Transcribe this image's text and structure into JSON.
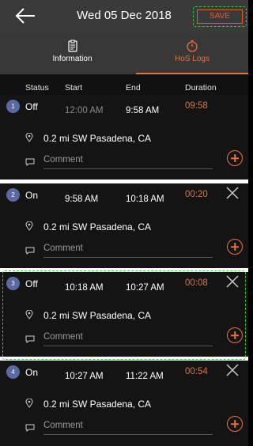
{
  "header": {
    "title": "Wed 05 Dec 2018",
    "save_label": "SAVE"
  },
  "tabs": [
    {
      "label": "Information",
      "icon": "clipboard-icon"
    },
    {
      "label": "HoS Logs",
      "icon": "timer-icon"
    }
  ],
  "columns": {
    "status": "Status",
    "start": "Start",
    "end": "End",
    "duration": "Duration"
  },
  "logs": [
    {
      "index": "1",
      "status": "Off",
      "start": "12:00 AM",
      "end": "9:58 AM",
      "duration": "09:58",
      "location": "0.2 mi SW Pasadena, CA",
      "comment_placeholder": "Comment",
      "deletable": false
    },
    {
      "index": "2",
      "status": "On",
      "start": "9:58 AM",
      "end": "10:18 AM",
      "duration": "00:20",
      "location": "0.2 mi SW Pasadena, CA",
      "comment_placeholder": "Comment",
      "deletable": true
    },
    {
      "index": "3",
      "status": "Off",
      "start": "10:18 AM",
      "end": "10:27 AM",
      "duration": "00:08",
      "location": "0.2 mi SW Pasadena, CA",
      "comment_placeholder": "Comment",
      "deletable": true
    },
    {
      "index": "4",
      "status": "On",
      "start": "10:27 AM",
      "end": "11:22 AM",
      "duration": "00:54",
      "location": "0.2 mi SW Pasadena, CA",
      "comment_placeholder": "Comment",
      "deletable": true
    }
  ],
  "colors": {
    "accent": "#e8703a",
    "badge": "#5a6aa0",
    "highlight": "#3cc33c"
  }
}
